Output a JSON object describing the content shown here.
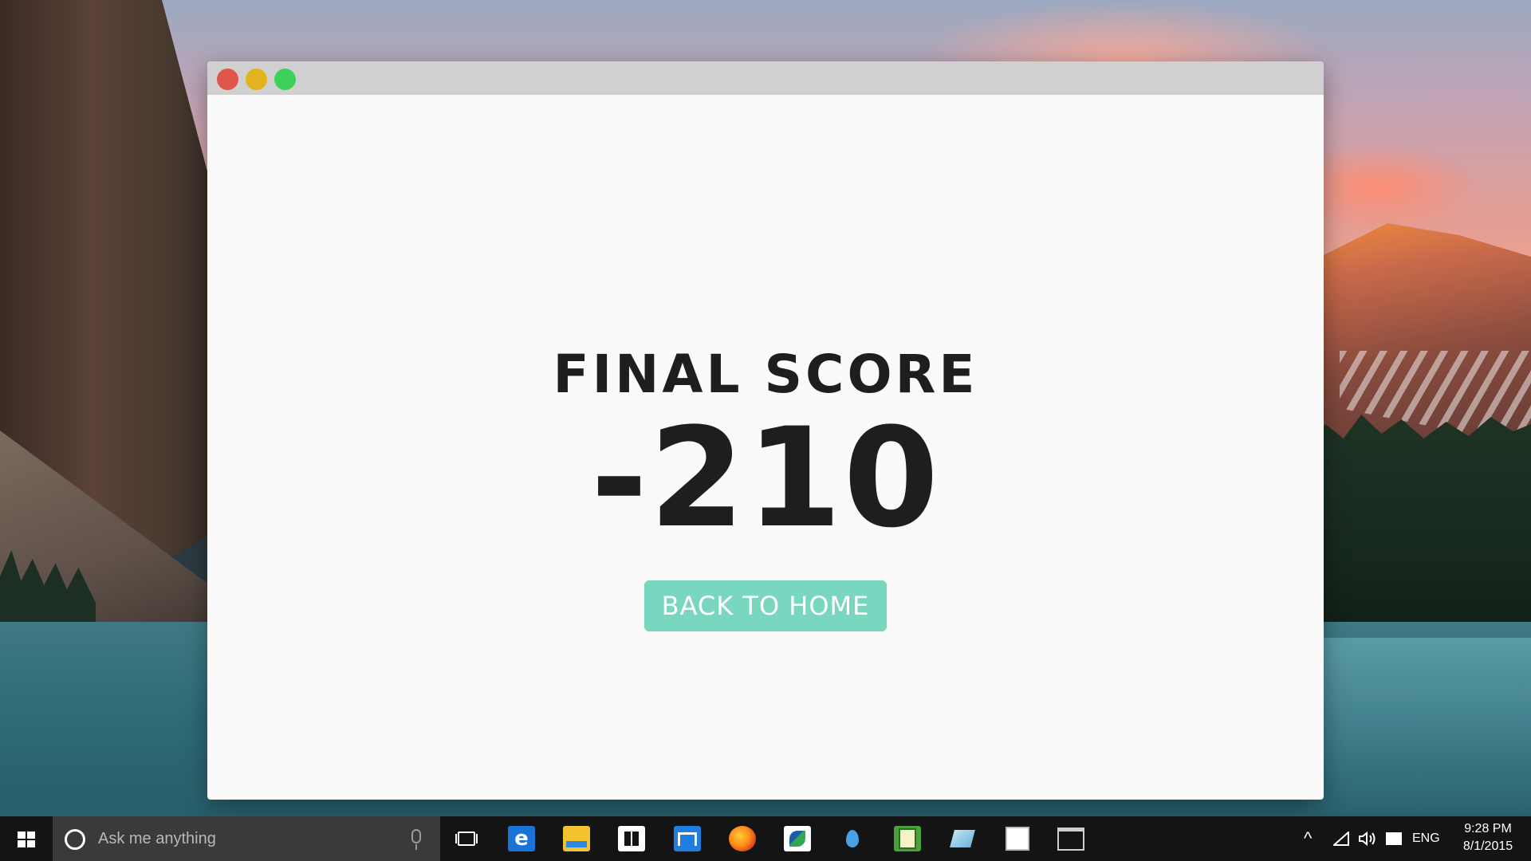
{
  "window": {
    "title_buttons": [
      "close",
      "minimize",
      "maximize"
    ]
  },
  "game_over": {
    "title": "FINAL SCORE",
    "score": "-210",
    "back_button_label": "BACK TO HOME"
  },
  "colors": {
    "button_accent": "#79d6bf",
    "close": "#e0564a",
    "minimize": "#e1b41f",
    "maximize": "#3ed15a"
  },
  "taskbar": {
    "search_placeholder": "Ask me anything",
    "pinned_icons": [
      "task-view-icon",
      "edge-icon",
      "file-explorer-icon",
      "store-icon",
      "app-icon",
      "firefox-icon",
      "app-icon",
      "drop-icon",
      "app-icon",
      "app-icon",
      "app-icon",
      "command-prompt-icon"
    ],
    "tray": {
      "chevron": "^",
      "language": "ENG"
    },
    "clock": {
      "time": "9:28 PM",
      "date": "8/1/2015"
    }
  }
}
